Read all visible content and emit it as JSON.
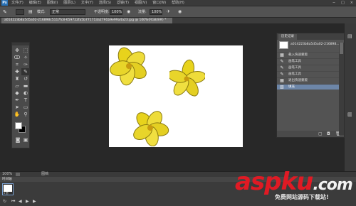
{
  "app": {
    "logo": "Ps"
  },
  "menubar": {
    "items": [
      "文件(F)",
      "编辑(E)",
      "图像(I)",
      "图层(L)",
      "文字(Y)",
      "选择(S)",
      "滤镜(T)",
      "视图(V)",
      "窗口(W)",
      "帮助(H)"
    ],
    "window_controls": [
      "−",
      "□",
      "×"
    ]
  },
  "options": {
    "mode_label": "模式:",
    "mode_value": "正常",
    "opacity_label": "不透明度:",
    "opacity_value": "100%",
    "flow_label": "流量:",
    "flow_value": "100%"
  },
  "document": {
    "tab_title": "a014223b8a5d5a02-216898c5117fc8-659722fa5b771713a2791b9e99a4a23.jpg @ 100%(RGB/8#) *"
  },
  "history_panel": {
    "tab": "历史记录",
    "snapshot_label": "a014223b8a5d5a02-216898...",
    "rows": [
      {
        "icon": "▦",
        "label": "载入快速蒙版"
      },
      {
        "icon": "✎",
        "label": "画笔工具"
      },
      {
        "icon": "✎",
        "label": "画笔工具"
      },
      {
        "icon": "✎",
        "label": "画笔工具"
      },
      {
        "icon": "▦",
        "label": "退出快速蒙版"
      },
      {
        "icon": "▧",
        "label": "填充"
      }
    ]
  },
  "statusbar": {
    "zoom": "100%",
    "info": "图档"
  },
  "timeline": {
    "title": "时间轴",
    "frame_time": "0 秒"
  },
  "watermark": {
    "brand": "aspku",
    "tld": ".com",
    "subtitle": "免费网站源码下载站!"
  },
  "colors": {
    "foreground": "#ffffff",
    "background": "#000000",
    "accent": "#6d86a8"
  }
}
